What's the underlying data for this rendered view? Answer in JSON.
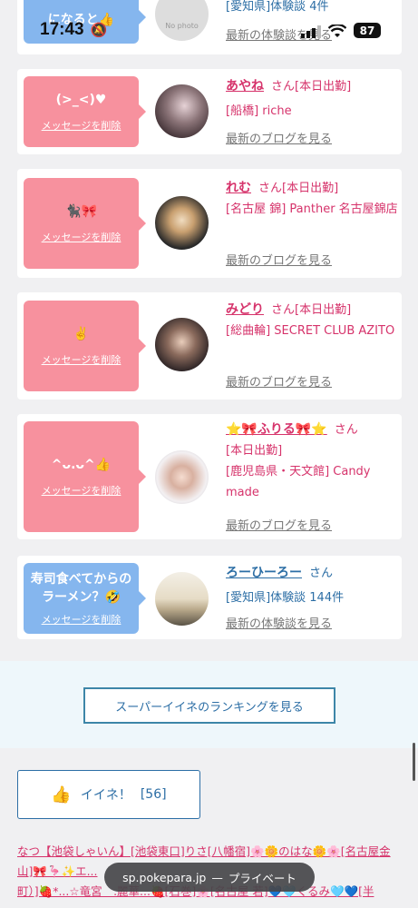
{
  "status_bar": {
    "time": "17:43",
    "battery": "87"
  },
  "cards": [
    {
      "bubble_text": "になると👍",
      "bubble_color": "blue",
      "name": "",
      "san": "",
      "status": "",
      "location": "[愛知県]体験談 4件",
      "more": "最新の体験談を見る",
      "avatar_text": "No photo"
    },
    {
      "bubble_text": "(>_<)♥",
      "bubble_color": "pink",
      "delete_label": "メッセージを削除",
      "name": "あやね",
      "san": "さん",
      "status": "[本日出勤]",
      "location": "[船橋] riche",
      "more": "最新のブログを見る"
    },
    {
      "bubble_text": "🐈‍⬛🎀",
      "bubble_color": "pink",
      "delete_label": "メッセージを削除",
      "name": "れむ",
      "san": "さん",
      "status": "[本日出勤]",
      "location": "[名古屋 錦] Panther 名古屋錦店",
      "more": "最新のブログを見る"
    },
    {
      "bubble_text": "✌️",
      "bubble_color": "pink",
      "delete_label": "メッセージを削除",
      "name": "みどり",
      "san": "さん",
      "status": "[本日出勤]",
      "location": "[総曲輪] SECRET CLUB AZITO",
      "more": "最新のブログを見る"
    },
    {
      "bubble_text": "^ᴗ.ᴗ^👍",
      "bubble_color": "pink",
      "delete_label": "メッセージを削除",
      "name": "⭐️🎀ふりる🎀⭐️",
      "san": "さん",
      "status": "[本日出勤]",
      "location": "[鹿児島県・天文館] Candy made",
      "more": "最新のブログを見る"
    },
    {
      "bubble_text": "寿司食べてからのラーメン？🤣",
      "bubble_color": "blue",
      "delete_label": "メッセージを削除",
      "name": "ろーひーろー",
      "san": "さん",
      "status": "",
      "location": "[愛知県]体験談 144件",
      "more": "最新の体験談を見る"
    }
  ],
  "ranking_button": "スーパーイイネのランキングを見る",
  "iine": {
    "label": "イイネ！",
    "count": "[56]"
  },
  "links_text": "なつ【池袋しゃいん】[池袋東口]りさ[八幡宿]🌸🌼のはな🌼🌸[名古屋金山]🎀🦩✨エ...",
  "links_text2": "町）]🍓*...☆竜宮　.麗華...🍓[石巻]🌸[名古屋 若]💙🩵くるみ🩵💙[半",
  "url_bar": {
    "domain": "sp.pokepara.jp",
    "separator": "—",
    "mode": "プライベート"
  },
  "colors": {
    "pink_accent": "#d6336b",
    "blue_accent": "#2c6ea5",
    "pink_bubble": "#f7919e",
    "blue_bubble": "#85b6ee"
  }
}
